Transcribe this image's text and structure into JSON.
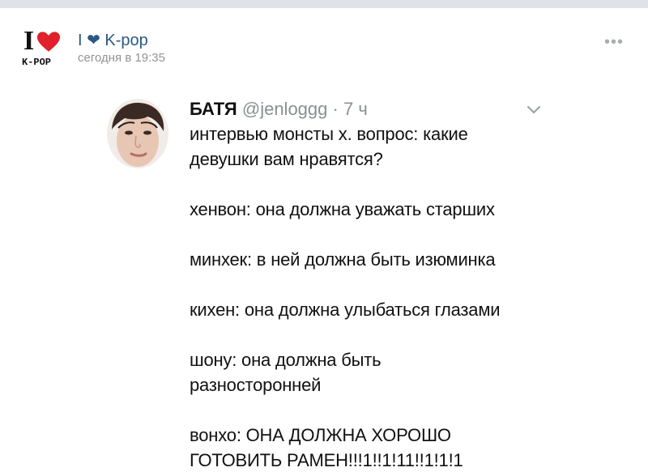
{
  "post": {
    "community_name": "I ❤ K-pop",
    "timestamp": "сегодня в 19:35",
    "logo": {
      "text": "K-POP",
      "letter": "I"
    },
    "more_icon": "more-dots-icon",
    "more_glyph": "•••"
  },
  "tweet": {
    "author_name": "БАТЯ",
    "handle": "@jenloggg",
    "separator": "·",
    "time": "7 ч",
    "menu_icon": "chevron-down-icon",
    "lines": [
      "интервью монсты х. вопрос: какие",
      "девушки вам нравятся?",
      "",
      "хенвон: она должна уважать старших",
      "",
      "минхек: в ней должна быть изюминка",
      "",
      "кихен: она должна улыбаться глазами",
      "",
      "шону: она должна быть",
      "разносторонней",
      "",
      "вонхо: ОНА ДОЛЖНА ХОРОШО",
      "ГОТОВИТЬ РАМЕН!!!1!!1!11!!1!1!1"
    ]
  },
  "colors": {
    "accent": "#2a5885",
    "secondary_text": "#939393",
    "heart": "#e0202a",
    "top_strip": "#dfe2e7"
  }
}
